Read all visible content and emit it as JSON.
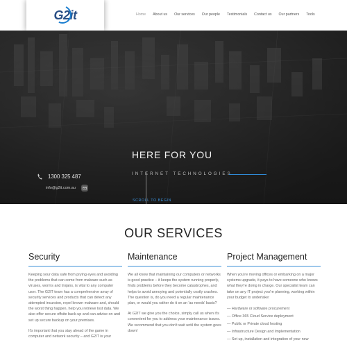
{
  "header": {
    "logo_text": "G2it",
    "nav": [
      "Home",
      "About us",
      "Our services",
      "Our people",
      "Testimonials",
      "Contact us",
      "Our partners",
      "Tools"
    ]
  },
  "hero": {
    "title": "HERE FOR YOU",
    "subtitle": "INTERNET TECHNOLOGIES",
    "scroll_label": "SCROLL TO BEGIN",
    "phone": "1300 325 487",
    "email": "info@g2it.com.au"
  },
  "services": {
    "title": "OUR SERVICES",
    "columns": [
      {
        "title": "Security",
        "paragraphs": [
          "Keeping your data safe from prying eyes and avoiding the problems that can come from malware such as viruses, worms and trojans, is vital to any computer user. The G2IT team has a comprehensive array of security services and products that can detect any attempted incursion, repel known malware and, should the worst thing happen, help you retrieve lost data. We also offer secure offsite back-up and can advise on and set up secure backup on your premises.",
          "It's important that you stay ahead of the game in computer and network security – and G2IT is your"
        ]
      },
      {
        "title": "Maintenance",
        "paragraphs": [
          "We all know that maintaining our computers or networks is good practice – it keeps the system running properly, finds problems before they become catastrophes, and helps to avoid annoying and potentially costly crashes. The question is, do you need a regular maintenance plan, or would you rather do it on an 'as needs' basis?",
          "At G2IT we give you the choice, simply call us when it's convenient for you to address your maintenance issues. We recommend that you don't wait until the system goes down!"
        ]
      },
      {
        "title": "Project Management",
        "paragraphs": [
          "When you're moving offices or embarking on a major systems upgrade, it pays to have someone who knows what they're doing in charge. Our specialist team can take on any IT project you're planning, working within your budget to undertake:"
        ],
        "list": [
          "— Hardware or software procurement",
          "— Office 365 Cloud Service deployment",
          "— Public or Private cloud hosting",
          "— Infrastructure Design and Implementation",
          "— Set up, installation and integration of your new"
        ]
      }
    ]
  }
}
